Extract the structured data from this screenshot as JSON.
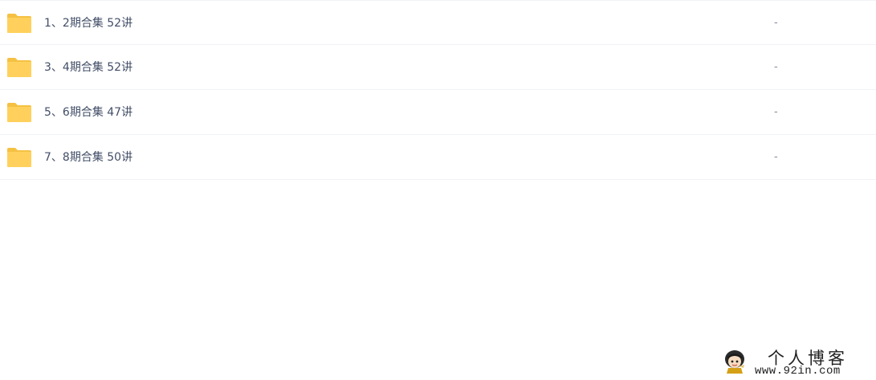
{
  "files": [
    {
      "name": "1、2期合集 52讲",
      "size": "-",
      "icon": "folder-icon"
    },
    {
      "name": "3、4期合集 52讲",
      "size": "-",
      "icon": "folder-icon"
    },
    {
      "name": "5、6期合集 47讲",
      "size": "-",
      "icon": "folder-icon"
    },
    {
      "name": "7、8期合集 50讲",
      "size": "-",
      "icon": "folder-icon"
    }
  ],
  "colors": {
    "folder": "#ffd15c",
    "folder_tab": "#f5c143",
    "text": "#424e67",
    "muted": "#878c9c",
    "divider": "#f1f3f7"
  },
  "watermark": {
    "title": "个人博客",
    "url": "www.92in.com",
    "icon": "cartoon-avatar-icon"
  }
}
